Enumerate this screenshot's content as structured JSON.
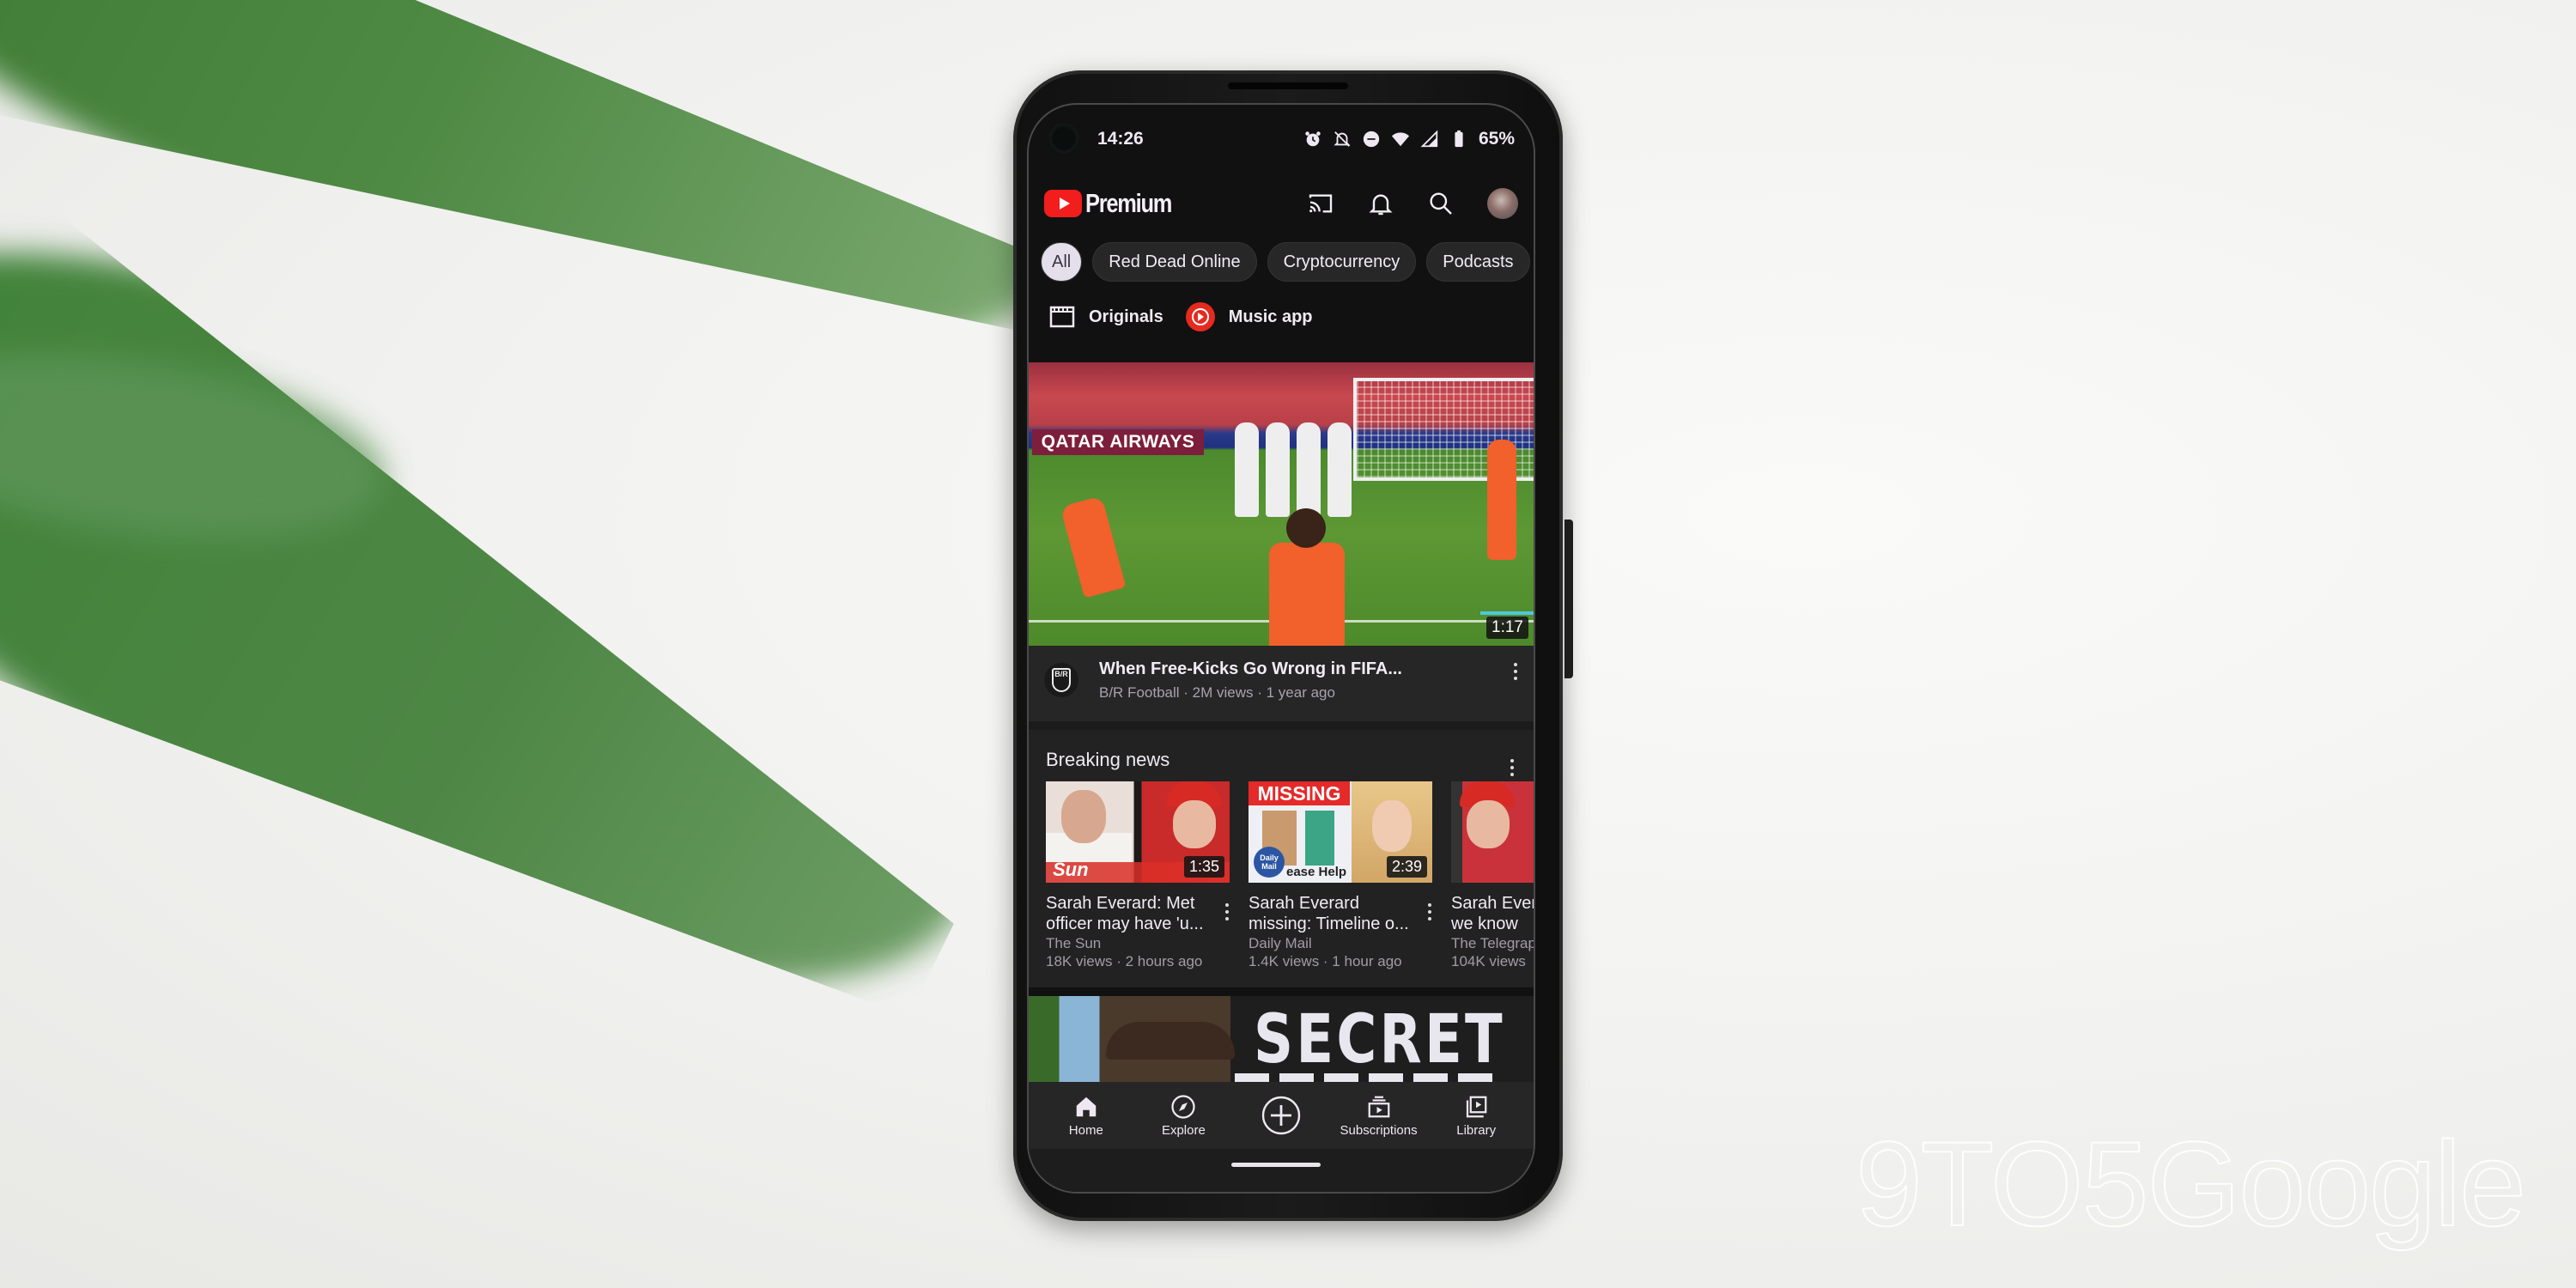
{
  "status_bar": {
    "time": "14:26",
    "battery": "65%",
    "icons": [
      "alarm-icon",
      "notifications-off-icon",
      "do-not-disturb-icon",
      "wifi-icon",
      "cellular-signal-icon",
      "battery-icon"
    ]
  },
  "app_bar": {
    "brand": "Premium",
    "actions": [
      "cast-icon",
      "notifications-bell-icon",
      "search-icon",
      "account-avatar"
    ]
  },
  "chips": [
    {
      "label": "All",
      "active": true
    },
    {
      "label": "Red Dead Online",
      "active": false
    },
    {
      "label": "Cryptocurrency",
      "active": false
    },
    {
      "label": "Podcasts",
      "active": false
    }
  ],
  "shortcuts": [
    {
      "label": "Originals",
      "icon": "clapperboard-icon"
    },
    {
      "label": "Music app",
      "icon": "youtube-music-icon"
    }
  ],
  "hero_video": {
    "duration": "1:17",
    "banner_text": "QATAR AIRWAYS",
    "title": "When Free-Kicks Go Wrong in FIFA...",
    "channel_avatar": "B/R",
    "subtitle": "B/R Football · 2M views · 1 year ago"
  },
  "breaking_news": {
    "header": "Breaking news",
    "cards": [
      {
        "title": "Sarah Everard: Met officer may have 'u...",
        "channel": "The Sun",
        "stats": "18K views · 2 hours ago",
        "duration": "1:35",
        "thumb_logo": "Sun"
      },
      {
        "title": "Sarah Everard missing: Timeline o...",
        "channel": "Daily Mail",
        "stats": "1.4K views · 1 hour ago",
        "duration": "2:39",
        "thumb_banner": "MISSING",
        "thumb_badge": "Daily Mail",
        "thumb_caption": "ease Help"
      },
      {
        "title": "Sarah Everard: What we know",
        "channel": "The Telegraph",
        "stats": "104K views"
      }
    ]
  },
  "next_video": {
    "thumb_text": "SECRET"
  },
  "bottom_nav": [
    {
      "label": "Home",
      "icon": "home-icon",
      "active": true
    },
    {
      "label": "Explore",
      "icon": "compass-icon"
    },
    {
      "label": "",
      "icon": "create-plus-icon"
    },
    {
      "label": "Subscriptions",
      "icon": "subscriptions-icon"
    },
    {
      "label": "Library",
      "icon": "library-icon"
    }
  ],
  "watermark": "9TO5Google",
  "colors": {
    "brand_red": "#f21d1d",
    "background_dark": "#111111",
    "surface": "#262626",
    "text_primary": "#f2ecf4",
    "text_secondary": "#a8a2ad",
    "active_chip": "#e4dfea"
  }
}
